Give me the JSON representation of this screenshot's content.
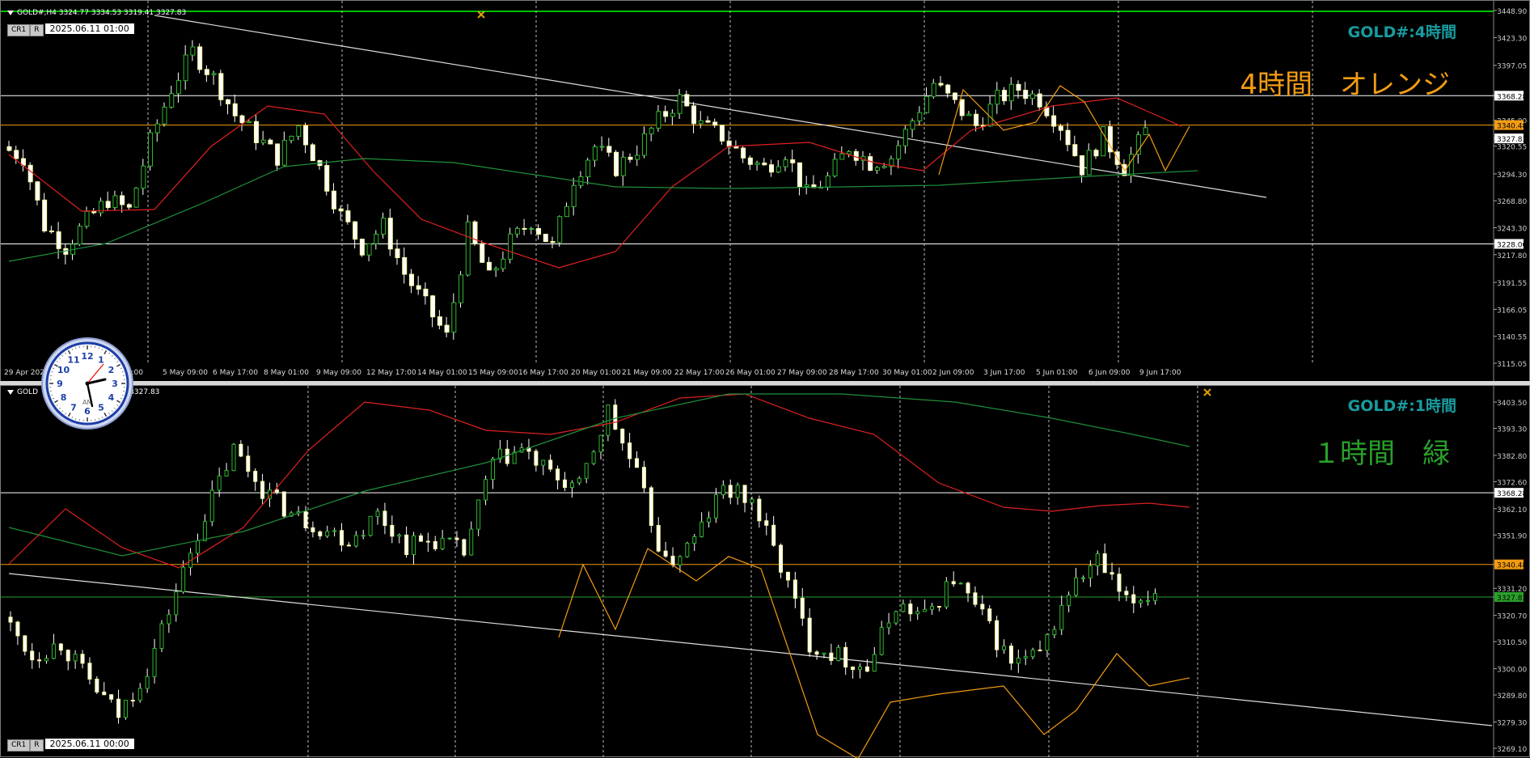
{
  "panels": [
    {
      "id": "h4",
      "header": "GOLD#,H4  3324.77 3334.53 3319.41 3327.83",
      "tag_cr": "CR1",
      "tag_r": "R",
      "date": "2025.06.11 01:00",
      "title": "GOLD#:4時間",
      "label": "4時間　オレンジ",
      "label_color": "#f39c12",
      "price_labels": [
        "3448.90",
        "3423.30",
        "3397.05",
        "3368.28",
        "3345.00",
        "3340.48",
        "3327.83",
        "3320.55",
        "3294.30",
        "3268.80",
        "3243.30",
        "3228.00",
        "3217.80",
        "3191.55",
        "3166.05",
        "3140.55",
        "3115.05"
      ],
      "time_labels": [
        "29 Apr 2025",
        "1 May 01:00",
        "5 May 09:00",
        "6 May 17:00",
        "8 May 01:00",
        "9 May 09:00",
        "12 May 17:00",
        "14 May 01:00",
        "15 May 09:00",
        "16 May 17:00",
        "20 May 01:00",
        "21 May 09:00",
        "22 May 17:00",
        "26 May 01:00",
        "27 May 09:00",
        "28 May 17:00",
        "30 May 01:00",
        "2 Jun 09:00",
        "3 Jun 17:00",
        "5 Jun 01:00",
        "6 Jun 09:00",
        "9 Jun 17:00"
      ]
    },
    {
      "id": "h1",
      "header": "GOLD",
      "header_tail": ".04 3327.83",
      "tag_cr": "CR1",
      "tag_r": "R",
      "date": "2025.06.11 00:00",
      "title": "GOLD#:1時間",
      "label": "１時間　緑",
      "label_color": "#2aa02a",
      "price_labels": [
        "3403.50",
        "3393.30",
        "3382.80",
        "3372.60",
        "3368.28",
        "3362.10",
        "3351.90",
        "3340.48",
        "3331.20",
        "3327.83",
        "3320.70",
        "3310.50",
        "3300.00",
        "3289.80",
        "3279.30",
        "3269.10"
      ]
    }
  ],
  "clock": {
    "am_label": "AM",
    "numbers": [
      "12",
      "1",
      "2",
      "3",
      "4",
      "5",
      "6",
      "7",
      "8",
      "9",
      "10",
      "11"
    ]
  },
  "colors": {
    "orange": "#f39c12",
    "red": "#e02020",
    "green": "#1f8f3a",
    "white": "#ffffff"
  }
}
